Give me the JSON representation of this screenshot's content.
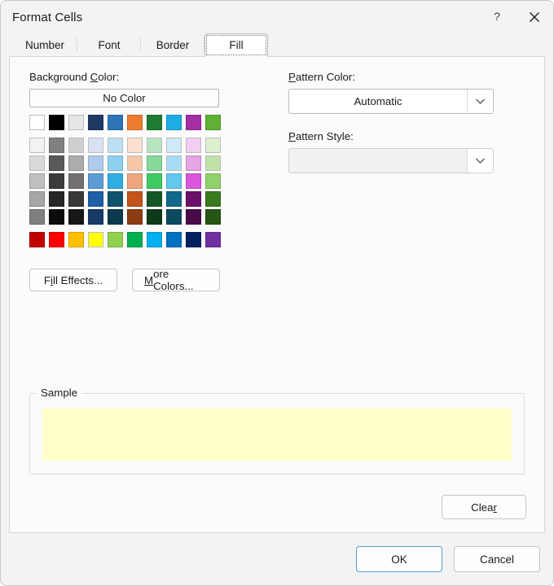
{
  "window": {
    "title": "Format Cells",
    "help_icon": "question-mark-icon",
    "close_icon": "close-icon"
  },
  "tabs": [
    {
      "label": "Number",
      "selected": false
    },
    {
      "label": "Font",
      "selected": false
    },
    {
      "label": "Border",
      "selected": false
    },
    {
      "label": "Fill",
      "selected": true
    }
  ],
  "fill_tab": {
    "background_color": {
      "label_pre": "Background ",
      "label_accel": "C",
      "label_post": "olor:",
      "no_color_label": "No Color"
    },
    "pattern_color": {
      "label_pre": "",
      "label_accel": "P",
      "label_post": "attern Color:",
      "value": "Automatic",
      "arrow_icon": "chevron-down-icon"
    },
    "pattern_style": {
      "label_pre": "",
      "label_accel": "P",
      "label_post": "attern Style:",
      "value": "",
      "arrow_icon": "chevron-down-icon",
      "disabled": true
    },
    "fill_effects_button": {
      "pre": "F",
      "accel": "i",
      "post": "ll Effects..."
    },
    "more_colors_button": {
      "pre": "",
      "accel": "M",
      "post": "ore Colors..."
    },
    "sample": {
      "legend": "Sample",
      "fill_color": "#FFFFCC"
    },
    "clear_button": {
      "pre": "Clea",
      "accel": "r",
      "post": ""
    }
  },
  "palette": {
    "theme_row": [
      "#FFFFFF",
      "#000000",
      "#E7E6E6",
      "#1F3864",
      "#2E75B6",
      "#ED7D31",
      "#1E7B31",
      "#1CADE4",
      "#A42FA4",
      "#5FB034"
    ],
    "variant_rows": [
      [
        "#F2F2F2",
        "#808080",
        "#D0CECE",
        "#D9E2F3",
        "#BDE0F4",
        "#FBE0D0",
        "#B6E5BF",
        "#CFEAF9",
        "#F3CEF3",
        "#DDF0CE"
      ],
      [
        "#D9D9D9",
        "#595959",
        "#AEABAB",
        "#AECBEB",
        "#8ED0EF",
        "#F8C6A6",
        "#87D99B",
        "#A6DDF6",
        "#E4A6E4",
        "#BFE3A6"
      ],
      [
        "#BFBFBF",
        "#3B3B3B",
        "#757070",
        "#5B9BD5",
        "#2FAEE4",
        "#EFA57E",
        "#3FCB62",
        "#63C9EE",
        "#DA56DA",
        "#8FD16B"
      ],
      [
        "#A6A6A6",
        "#262626",
        "#3A3838",
        "#1F5FA8",
        "#10536F",
        "#C3551A",
        "#155724",
        "#126A8A",
        "#691069",
        "#3A7A1F"
      ],
      [
        "#808080",
        "#0D0D0D",
        "#181616",
        "#173A66",
        "#0B3A4E",
        "#8C3C12",
        "#0D3A18",
        "#0C4A60",
        "#470A47",
        "#275514"
      ]
    ],
    "standard_row": [
      "#C00000",
      "#FF0000",
      "#FFC000",
      "#FFFF00",
      "#92D050",
      "#00B050",
      "#00B0F0",
      "#0070C0",
      "#002060",
      "#7030A0"
    ]
  },
  "footer": {
    "ok_label": "OK",
    "cancel_label": "Cancel"
  }
}
